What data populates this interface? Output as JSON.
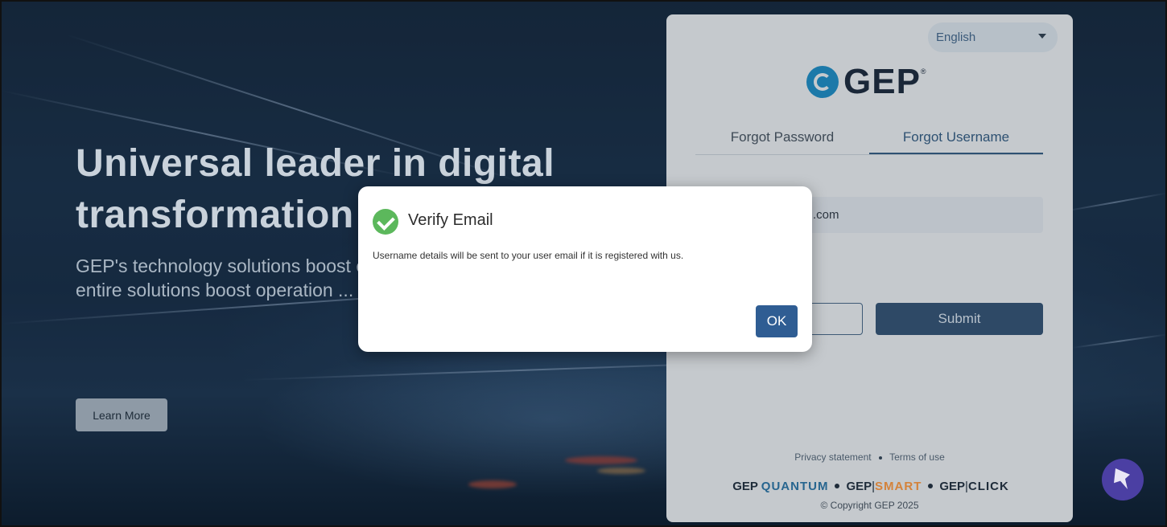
{
  "hero": {
    "title": "Universal leader in digital transformation",
    "description": "GEP's technology solutions boost efficiency and provide real-time ... entire solutions boost operation ... supply chain...",
    "learn_more": "Learn More"
  },
  "login": {
    "language": "English",
    "logo_text": "GEP",
    "tabs": [
      {
        "label": "Forgot Password",
        "active": false
      },
      {
        "label": "Forgot Username",
        "active": true
      }
    ],
    "email_value": ".com",
    "submit_label": "Submit",
    "footer": {
      "privacy": "Privacy statement",
      "terms": "Terms of use",
      "copyright": "© Copyright GEP 2025"
    },
    "products": {
      "gep": "GEP",
      "quantum": "QUANTUM",
      "smart": "SMART",
      "click": "CLICK"
    }
  },
  "modal": {
    "title": "Verify Email",
    "message": "Username details will be sent to your user email if it is registered with us.",
    "ok_label": "OK"
  },
  "colors": {
    "accent": "#2f5d93",
    "success": "#5cb85c",
    "smart_orange": "#d4823a"
  }
}
